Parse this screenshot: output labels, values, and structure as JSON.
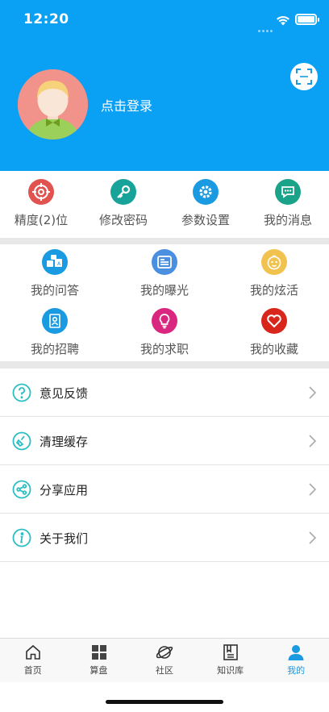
{
  "status_bar": {
    "time": "12:20"
  },
  "profile": {
    "login_text": "点击登录"
  },
  "quick_actions": [
    {
      "label": "精度(2)位",
      "icon": "target-icon",
      "color": "#e0534f"
    },
    {
      "label": "修改密码",
      "icon": "key-icon",
      "color": "#17a39a"
    },
    {
      "label": "参数设置",
      "icon": "gear-icon",
      "color": "#1a9ae0"
    },
    {
      "label": "我的消息",
      "icon": "chat-bubble-icon",
      "color": "#1aa389"
    }
  ],
  "my_grid": [
    {
      "label": "我的问答",
      "icon": "qa-blocks-icon",
      "color": "#1a9ae0"
    },
    {
      "label": "我的曝光",
      "icon": "card-icon",
      "color": "#4a8fe0"
    },
    {
      "label": "我的炫活",
      "icon": "baby-face-icon",
      "color": "#f2c24f"
    },
    {
      "label": "我的招聘",
      "icon": "portrait-doc-icon",
      "color": "#1a9ae0"
    },
    {
      "label": "我的求职",
      "icon": "lightbulb-icon",
      "color": "#d9277f"
    },
    {
      "label": "我的收藏",
      "icon": "heart-icon",
      "color": "#d9261c"
    }
  ],
  "menu": [
    {
      "label": "意见反馈",
      "icon": "question-circle-icon"
    },
    {
      "label": "清理缓存",
      "icon": "broom-icon"
    },
    {
      "label": "分享应用",
      "icon": "share-icon"
    },
    {
      "label": "关于我们",
      "icon": "info-icon"
    }
  ],
  "menu_icon_color": "#2bbfc4",
  "tabbar": {
    "active_color": "#1a9ae0",
    "tabs": [
      {
        "label": "首页",
        "icon": "home-icon"
      },
      {
        "label": "算盘",
        "icon": "grid-squares-icon"
      },
      {
        "label": "社区",
        "icon": "planet-icon"
      },
      {
        "label": "知识库",
        "icon": "document-icon"
      },
      {
        "label": "我的",
        "icon": "person-icon",
        "active": true
      }
    ]
  }
}
